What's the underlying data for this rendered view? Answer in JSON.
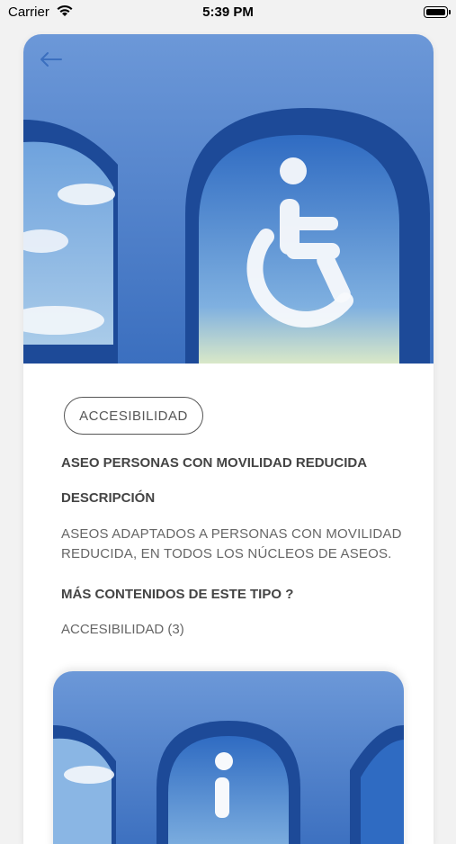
{
  "status_bar": {
    "carrier": "Carrier",
    "time": "5:39 PM"
  },
  "nav": {
    "back_icon": "arrow-left-icon"
  },
  "detail": {
    "category_tag": "ACCESIBILIDAD",
    "title": "ASEO PERSONAS CON MOVILIDAD REDUCIDA",
    "description_heading": "DESCRIPCIÓN",
    "description": "ASEOS ADAPTADOS A PERSONAS CON MOVILIDAD REDUCIDA, EN TODOS LOS NÚCLEOS DE ASEOS.",
    "more_heading": "MÁS CONTENIDOS DE ESTE TIPO ?",
    "more_link": "ACCESIBILIDAD (3)"
  },
  "colors": {
    "sky_blue": "#3f78c9",
    "arch_dark": "#1f4fa3",
    "text_dark": "#444444",
    "text_muted": "#666666"
  }
}
